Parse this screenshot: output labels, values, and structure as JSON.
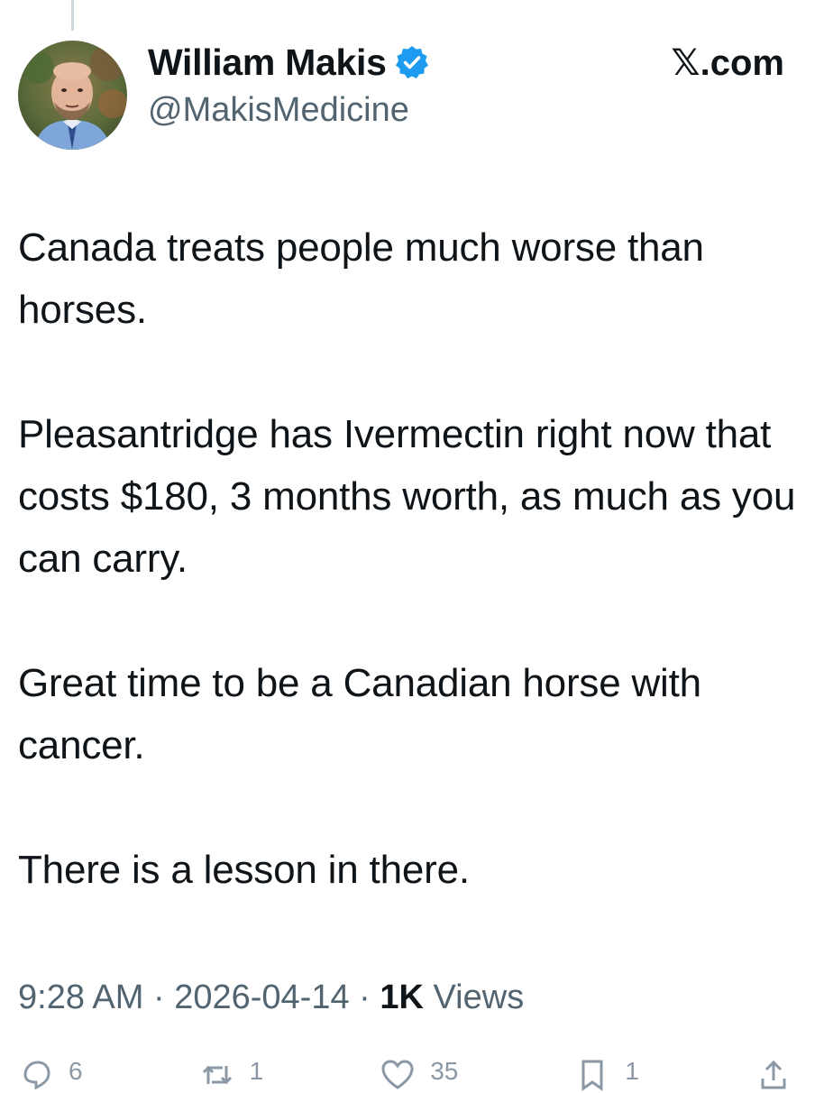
{
  "header": {
    "display_name": "William Makis",
    "handle": "@MakisMedicine",
    "site_label": ".com",
    "site_logo_glyph": "𝕏"
  },
  "tweet": {
    "paragraphs": [
      "Canada treats people much worse than horses.",
      "Pleasantridge has Ivermectin right now that costs $180, 3 months worth, as much as you can carry.",
      "Great time to be a Canadian horse with cancer.",
      "There is a lesson in there."
    ]
  },
  "meta": {
    "time": "9:28 AM",
    "separator": " · ",
    "date": "2026-04-14",
    "views_count": "1K",
    "views_label": " Views"
  },
  "actions": {
    "reply_count": "6",
    "repost_count": "1",
    "like_count": "35",
    "bookmark_count": "1"
  },
  "colors": {
    "text": "#0f1419",
    "secondary": "#536471",
    "verified": "#1d9bf0"
  }
}
